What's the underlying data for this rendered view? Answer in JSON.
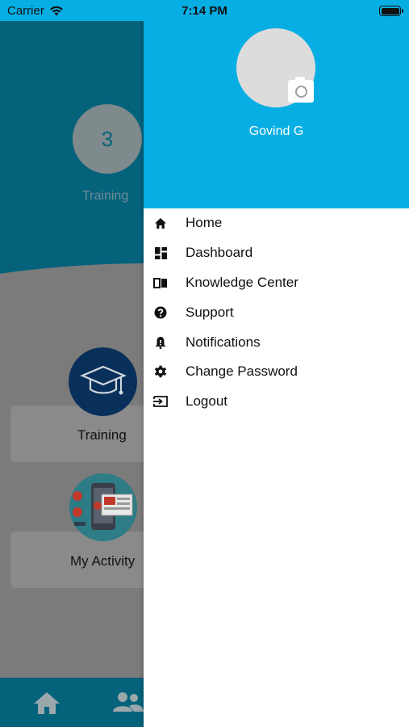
{
  "status_bar": {
    "carrier": "Carrier",
    "time": "7:14 PM"
  },
  "background": {
    "count_value": "3",
    "count_label": "Training",
    "cards": [
      {
        "label": "Training"
      },
      {
        "label": "My Activity"
      }
    ]
  },
  "drawer": {
    "user_name": "Govind G",
    "menu": [
      {
        "label": "Home",
        "icon": "home-icon"
      },
      {
        "label": "Dashboard",
        "icon": "dashboard-icon"
      },
      {
        "label": "Knowledge Center",
        "icon": "book-icon"
      },
      {
        "label": "Support",
        "icon": "help-icon"
      },
      {
        "label": "Notifications",
        "icon": "bell-icon"
      },
      {
        "label": "Change Password",
        "icon": "gear-icon"
      },
      {
        "label": "Logout",
        "icon": "logout-icon"
      }
    ]
  },
  "colors": {
    "header": "#07aee4",
    "dimmed_primary": "#05627b"
  }
}
